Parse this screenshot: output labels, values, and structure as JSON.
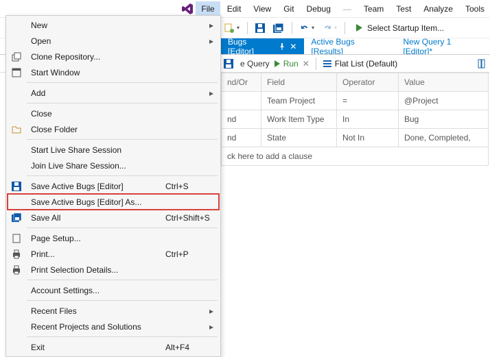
{
  "menubar": {
    "items": [
      "File",
      "Edit",
      "View",
      "Git",
      "Debug",
      "—",
      "Team",
      "Test",
      "Analyze",
      "Tools"
    ]
  },
  "toolbar": {
    "startup_label": "Select Startup Item..."
  },
  "tabs": [
    {
      "label": "Bugs [Editor]",
      "active": true,
      "pinned": true,
      "closable": true
    },
    {
      "label": "Active Bugs [Results]",
      "active": false
    },
    {
      "label": "New Query 1 [Editor]*",
      "active": false
    }
  ],
  "querybar": {
    "save_fragment": "e Query",
    "run": "Run",
    "flatlist": "Flat List (Default)"
  },
  "table": {
    "headers": [
      "nd/Or",
      "Field",
      "Operator",
      "Value"
    ],
    "rows": [
      [
        "",
        "Team Project",
        "=",
        "@Project"
      ],
      [
        "nd",
        "Work Item Type",
        "In",
        "Bug"
      ],
      [
        "nd",
        "State",
        "Not In",
        "Done, Completed,"
      ]
    ],
    "add_clause": "ck here to add a clause"
  },
  "file_menu": [
    {
      "type": "item",
      "label": "New",
      "submenu": true
    },
    {
      "type": "item",
      "label": "Open",
      "submenu": true
    },
    {
      "type": "item",
      "label": "Clone Repository...",
      "icon": "clone"
    },
    {
      "type": "item",
      "label": "Start Window",
      "icon": "window"
    },
    {
      "type": "sep"
    },
    {
      "type": "item",
      "label": "Add",
      "submenu": true
    },
    {
      "type": "sep"
    },
    {
      "type": "item",
      "label": "Close"
    },
    {
      "type": "item",
      "label": "Close Folder",
      "icon": "folder"
    },
    {
      "type": "sep"
    },
    {
      "type": "item",
      "label": "Start Live Share Session"
    },
    {
      "type": "item",
      "label": "Join Live Share Session..."
    },
    {
      "type": "sep"
    },
    {
      "type": "item",
      "label": "Save Active Bugs [Editor]",
      "icon": "save",
      "shortcut": "Ctrl+S"
    },
    {
      "type": "item",
      "label": "Save Active Bugs [Editor] As...",
      "highlight": true
    },
    {
      "type": "item",
      "label": "Save All",
      "icon": "saveall",
      "shortcut": "Ctrl+Shift+S"
    },
    {
      "type": "sep"
    },
    {
      "type": "item",
      "label": "Page Setup...",
      "icon": "page"
    },
    {
      "type": "item",
      "label": "Print...",
      "icon": "print",
      "shortcut": "Ctrl+P"
    },
    {
      "type": "item",
      "label": "Print Selection Details...",
      "icon": "print"
    },
    {
      "type": "sep"
    },
    {
      "type": "item",
      "label": "Account Settings..."
    },
    {
      "type": "sep"
    },
    {
      "type": "item",
      "label": "Recent Files",
      "submenu": true
    },
    {
      "type": "item",
      "label": "Recent Projects and Solutions",
      "submenu": true
    },
    {
      "type": "sep"
    },
    {
      "type": "item",
      "label": "Exit",
      "shortcut": "Alt+F4"
    }
  ]
}
